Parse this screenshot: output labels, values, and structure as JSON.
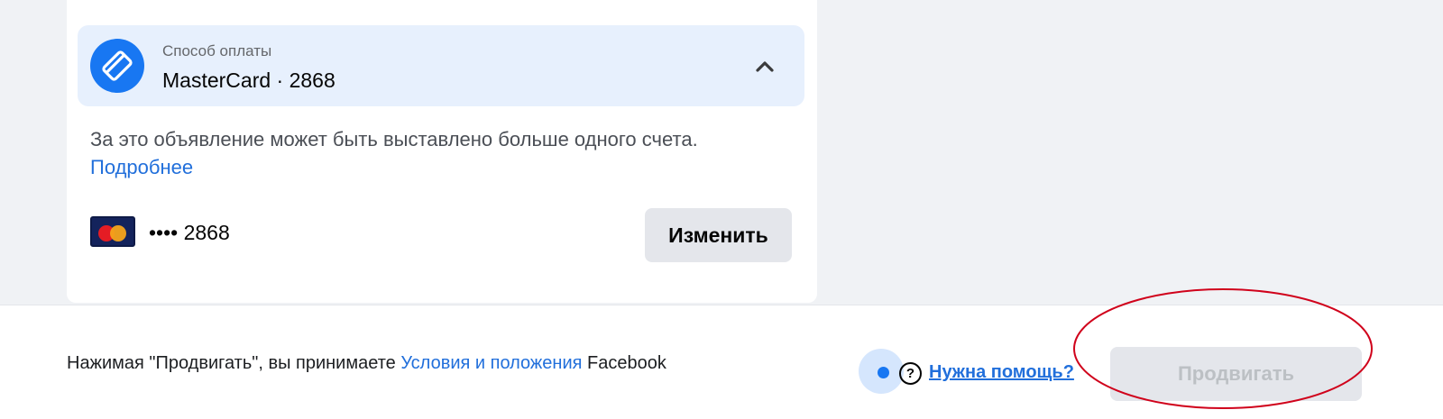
{
  "payment": {
    "subtitle": "Способ оплаты",
    "title": "MasterCard · 2868",
    "icon": "credit-card-icon",
    "collapse_icon": "chevron-up-icon"
  },
  "note": {
    "text": "За это объявление может быть выставлено больше одного счета.",
    "link": "Подробнее"
  },
  "card": {
    "brand_icon": "mastercard-icon",
    "masked_number": "•••• 2868",
    "change_label": "Изменить"
  },
  "footer": {
    "terms_prefix": "Нажимая \"Продвигать\", вы принимаете",
    "terms_link": "Условия и положения",
    "terms_suffix": "Facebook",
    "help_label": "Нужна помощь?",
    "help_icon": "question-icon",
    "promote_label": "Продвигать"
  },
  "colors": {
    "accent": "#1877f2",
    "link": "#216fdb",
    "annotation": "#d0021b"
  }
}
